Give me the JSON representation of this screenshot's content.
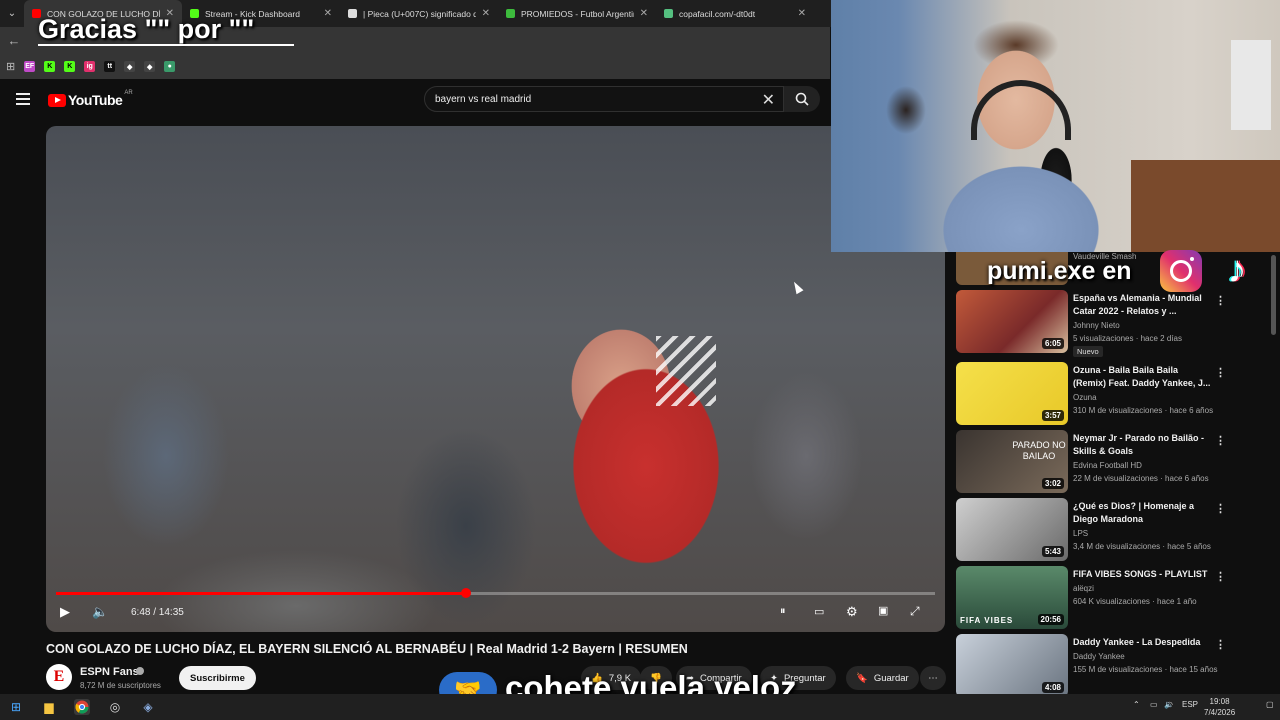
{
  "browser": {
    "tabs": [
      {
        "title": "CON GOLAZO DE LUCHO DÍAZ",
        "color": "#ff0000",
        "active": true
      },
      {
        "title": "Stream - Kick Dashboard",
        "color": "#53fc18",
        "active": false
      },
      {
        "title": "| Pieca (U+007C) significado de",
        "color": "#dddddd",
        "active": false
      },
      {
        "title": "PROMIEDOS - Futbol Argentino",
        "color": "#3dbb3d",
        "active": false
      },
      {
        "title": "copafacil.com/-dt0dt",
        "color": "#55c080",
        "active": false
      }
    ],
    "bookmarks": [
      "EF",
      "K",
      "K",
      "ig",
      "tt",
      "◆",
      "◆",
      "●"
    ]
  },
  "youtube": {
    "logo_text": "YouTube",
    "region": "AR",
    "search_value": "bayern vs real madrid"
  },
  "player": {
    "current_time": "6:48",
    "duration": "14:35",
    "time_display": "6:48 / 14:35",
    "progress": 0.466
  },
  "video": {
    "title": "CON GOLAZO DE LUCHO DÍAZ, EL BAYERN SILENCIÓ AL BERNABÉU | Real Madrid 1-2 Bayern | RESUMEN",
    "channel": "ESPN Fans",
    "subscribers": "8,72 M de suscriptores",
    "subscribe_label": "Suscribirme",
    "likes": "7,9 K",
    "share_label": "Compartir",
    "ask_label": "Preguntar",
    "save_label": "Guardar"
  },
  "recommendations": [
    {
      "title": "",
      "channel": "Vaudeville Smash",
      "meta": "",
      "duration": "",
      "thumb": "#7a5a3a",
      "partial": true
    },
    {
      "title": "España vs Alemania - Mundial Catar 2022 - Relatos y ...",
      "channel": "Johnny Nieto",
      "meta": "5 visualizaciones · hace 2 días",
      "duration": "6:05",
      "badge": "Nuevo",
      "thumb": "#b4483a"
    },
    {
      "title": "Ozuna - Baila Baila Baila (Remix) Feat. Daddy Yankee, J...",
      "channel": "Ozuna",
      "meta": "310 M de visualizaciones · hace 6 años",
      "duration": "3:57",
      "thumb": "#f2d83a"
    },
    {
      "title": "Neymar Jr - Parado no Bailão - Skills & Goals",
      "channel": "Edvina Football HD",
      "meta": "22 M de visualizaciones · hace 6 años",
      "duration": "3:02",
      "thumb": "#5a5048",
      "thumb_text": "PARADO NO BAILAO"
    },
    {
      "title": "¿Qué es Dios? | Homenaje a Diego Maradona",
      "channel": "LPS",
      "meta": "3,4 M de visualizaciones · hace 5 años",
      "duration": "5:43",
      "thumb": "#8a8a8a"
    },
    {
      "title": "FIFA VIBES SONGS - PLAYLIST",
      "channel": "alëqzi",
      "meta": "604 K visualizaciones · hace 1 año",
      "duration": "20:56",
      "thumb": "#3a6a4a",
      "thumb_text": "FIFA VIBES"
    },
    {
      "title": "Daddy Yankee - La Despedida",
      "channel": "Daddy Yankee",
      "meta": "155 M de visualizaciones · hace 15 años",
      "duration": "4:08",
      "thumb": "#9aa4b0"
    }
  ],
  "overlays": {
    "thanks": "Gracias \"\" por \"\"",
    "social": "pumi.exe en",
    "cohete": "cohete.vuela.veloz"
  },
  "taskbar": {
    "lang": "ESP",
    "time": "19:08",
    "date": "7/4/2026"
  },
  "colors": {
    "accent": "#ff0000",
    "bg": "#0f0f0f"
  }
}
